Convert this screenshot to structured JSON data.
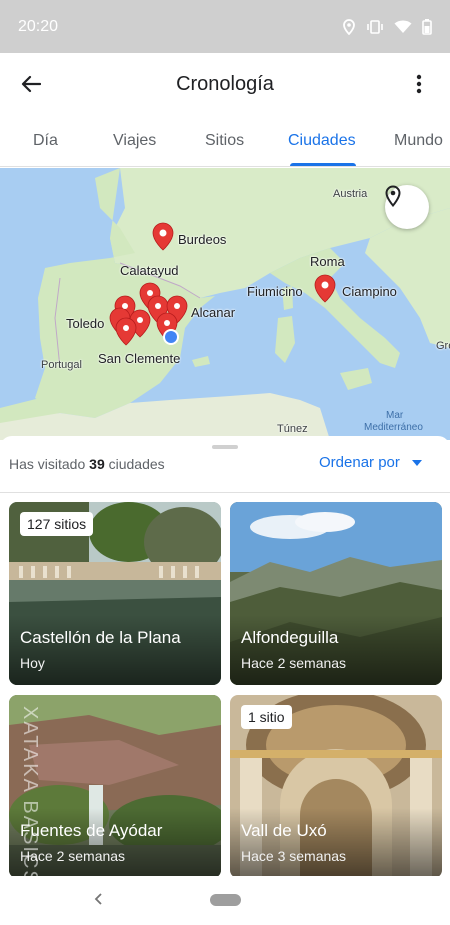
{
  "status_bar": {
    "time": "20:20",
    "icons": [
      "location-icon",
      "vibrate-icon",
      "wifi-icon",
      "battery-icon"
    ]
  },
  "app_bar": {
    "title": "Cronología",
    "back_icon": "arrow-left-icon",
    "menu_icon": "more-vert-icon"
  },
  "tabs": [
    {
      "label": "Día",
      "active": false
    },
    {
      "label": "Viajes",
      "active": false
    },
    {
      "label": "Sitios",
      "active": false
    },
    {
      "label": "Ciudades",
      "active": true
    },
    {
      "label": "Mundo",
      "active": false
    }
  ],
  "map": {
    "labels": {
      "austria": "Austria",
      "burdeos": "Burdeos",
      "calatayud": "Calatayud",
      "roma": "Roma",
      "fiumicino": "Fiumicino",
      "ciampino": "Ciampino",
      "toledo": "Toledo",
      "alcanar": "Alcanar",
      "portugal": "Portugal",
      "san_clemente": "San Clemente",
      "gre": "Gre",
      "tunez": "Túnez",
      "mar": "Mar",
      "mediterraneo": "Mediterráneo"
    },
    "locate_icon": "map-pin-icon",
    "colors": {
      "sea": "#a8cdf2",
      "land": "#cfe6bf",
      "pin": "#e53935",
      "current": "#4285f4"
    }
  },
  "sheet": {
    "visited_prefix": "Has visitado",
    "visited_count": "39",
    "visited_suffix": "ciudades",
    "sort_label": "Ordenar por",
    "sort_icon": "dropdown-arrow-icon"
  },
  "cities": [
    {
      "name": "Castellón de la Plana",
      "when": "Hoy",
      "badge": "127 sitios"
    },
    {
      "name": "Alfondeguilla",
      "when": "Hace 2 semanas",
      "badge": ""
    },
    {
      "name": "Fuentes de Ayódar",
      "when": "Hace 2 semanas",
      "badge": ""
    },
    {
      "name": "Vall de Uxó",
      "when": "Hace 3 semanas",
      "badge": "1 sitio"
    }
  ],
  "watermark": "XATAKA BASICS",
  "nav": {
    "back_icon": "nav-back-icon",
    "home_icon": "home-pill-icon"
  }
}
